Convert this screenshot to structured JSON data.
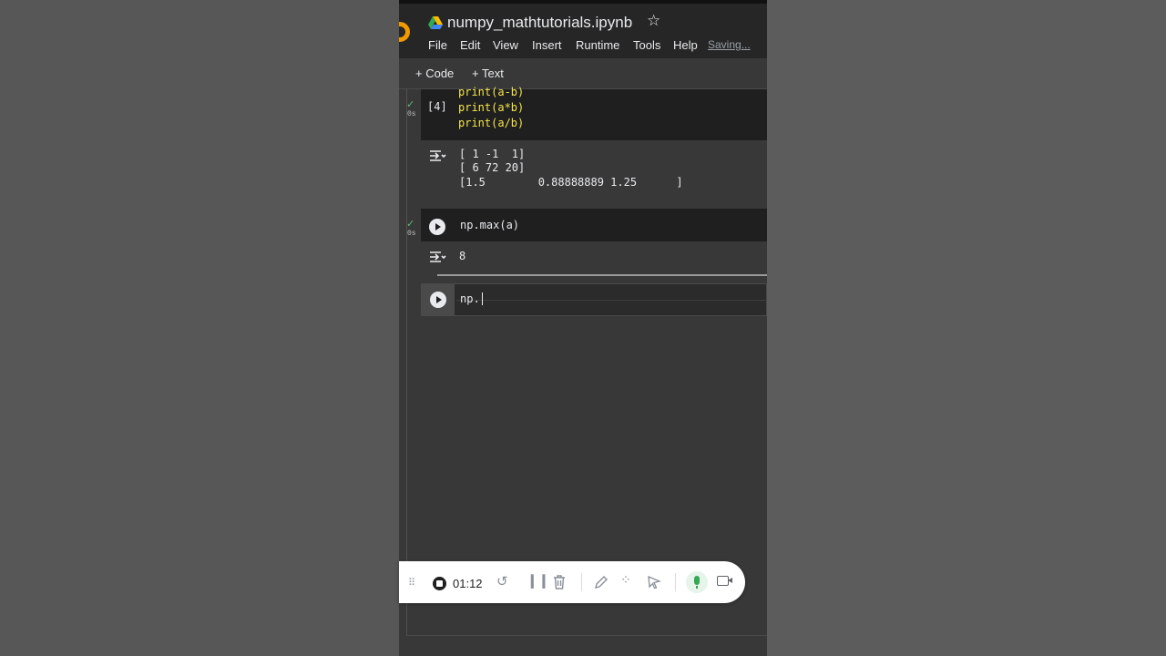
{
  "notebook": {
    "title": "numpy_mathtutorials.ipynb",
    "star_icon": "star-icon",
    "menu": [
      "File",
      "Edit",
      "View",
      "Insert",
      "Runtime",
      "Tools",
      "Help"
    ],
    "status": "Saving..."
  },
  "toolbar": {
    "add_code": "+ Code",
    "add_text": "+ Text"
  },
  "cells": {
    "cell1": {
      "exec_count": "[4]",
      "status_check": "✓",
      "duration": "0s",
      "lines": [
        "print(a-b)",
        "print(a*b)",
        "print(a/b)"
      ],
      "output": [
        "[ 1 -1  1]",
        "[ 6 72 20]",
        "[1.5        0.88888889 1.25      ]"
      ]
    },
    "cell2": {
      "status_check": "✓",
      "duration": "0s",
      "code": "np.max(a)",
      "output": "8"
    },
    "cell3": {
      "code": "np."
    }
  },
  "recorder": {
    "time": "01:12",
    "colors": {
      "mic_active": "#34a853"
    }
  }
}
